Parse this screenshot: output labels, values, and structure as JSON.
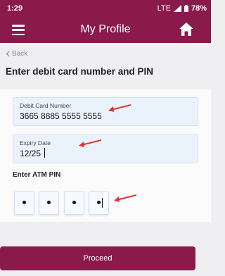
{
  "status_bar": {
    "time": "1:29",
    "network": "LTE",
    "battery": "78%"
  },
  "app_bar": {
    "title": "My Profile",
    "menu_icon": "hamburger-menu-icon",
    "home_icon": "home-icon"
  },
  "back": {
    "label": "Back"
  },
  "heading": "Enter debit card number and PIN",
  "form": {
    "card_number": {
      "label": "Debit Card Number",
      "value": "3665 8885 5555 5555"
    },
    "expiry": {
      "label": "Expiry Date",
      "value": "12/25"
    },
    "pin": {
      "label": "Enter ATM PIN",
      "digits": [
        "•",
        "•",
        "•",
        "•"
      ]
    }
  },
  "proceed": {
    "label": "Proceed"
  },
  "colors": {
    "brand": "#8a1a4c",
    "field_bg": "#eaf3fc",
    "page_bg": "#efeff1",
    "annotation": "#e3342f"
  }
}
